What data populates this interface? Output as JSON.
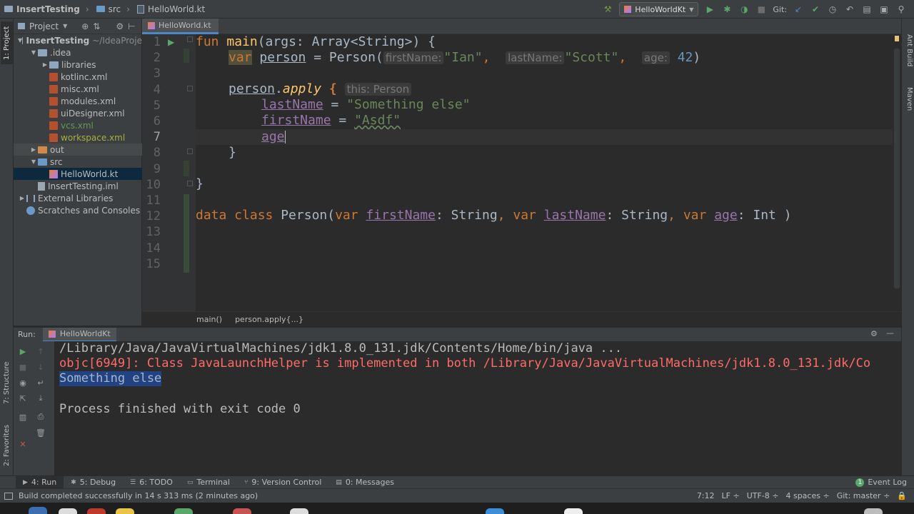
{
  "breadcrumbs": [
    "InsertTesting",
    "src",
    "HelloWorld.kt"
  ],
  "run_config": "HelloWorldKt",
  "git_label": "Git:",
  "left_stripe": [
    "1: Project",
    "7: Structure",
    "2: Favorites"
  ],
  "right_stripe": [
    "Ant Build",
    "Maven"
  ],
  "project_panel": {
    "view": "Project",
    "tree": [
      {
        "label": "InsertTesting",
        "suffix": "~/IdeaProje",
        "depth": 0,
        "arrow": "down",
        "icon": "folder",
        "bold": true
      },
      {
        "label": ".idea",
        "depth": 1,
        "arrow": "down",
        "icon": "folder"
      },
      {
        "label": "libraries",
        "depth": 2,
        "arrow": "right",
        "icon": "folder"
      },
      {
        "label": "kotlinc.xml",
        "depth": 2,
        "arrow": "",
        "icon": "xml"
      },
      {
        "label": "misc.xml",
        "depth": 2,
        "arrow": "",
        "icon": "xml"
      },
      {
        "label": "modules.xml",
        "depth": 2,
        "arrow": "",
        "icon": "xml"
      },
      {
        "label": "uiDesigner.xml",
        "depth": 2,
        "arrow": "",
        "icon": "xml"
      },
      {
        "label": "vcs.xml",
        "depth": 2,
        "arrow": "",
        "icon": "xml",
        "color": "#629755"
      },
      {
        "label": "workspace.xml",
        "depth": 2,
        "arrow": "",
        "icon": "xml",
        "color": "#a6b03d"
      },
      {
        "label": "out",
        "depth": 1,
        "arrow": "right",
        "icon": "folder-orange",
        "highlight": true
      },
      {
        "label": "src",
        "depth": 1,
        "arrow": "down",
        "icon": "folder-blue"
      },
      {
        "label": "HelloWorld.kt",
        "depth": 2,
        "arrow": "",
        "icon": "kt",
        "selected": true
      },
      {
        "label": "InsertTesting.iml",
        "depth": 1,
        "arrow": "",
        "icon": "iml"
      },
      {
        "label": "External Libraries",
        "depth": 0,
        "arrow": "right",
        "icon": "lib"
      },
      {
        "label": "Scratches and Consoles",
        "depth": 0,
        "arrow": "",
        "icon": "scratch"
      }
    ]
  },
  "editor": {
    "tab": "HelloWorld.kt",
    "line_numbers": [
      "1",
      "2",
      "3",
      "4",
      "5",
      "6",
      "7",
      "8",
      "9",
      "10",
      "11",
      "12",
      "13",
      "14",
      "15"
    ],
    "current_line": 7,
    "code": {
      "l1_fun": "fun ",
      "l1_main": "main",
      "l1_rest": "(args: Array<String>) {",
      "l2_var": "var",
      "l2_person": "person",
      "l2_eq": " = Person(",
      "l2_hint1": "firstName:",
      "l2_str1": "\"Ian\"",
      "l2_comma": ",",
      "l2_hint2": "lastName:",
      "l2_str2": "\"Scott\"",
      "l2_hint3": "age:",
      "l2_num": "42",
      "l2_close": ")",
      "l4_person": "person",
      "l4_dot": ".",
      "l4_apply": "apply",
      "l4_brace": " {",
      "l4_hint": "this: Person",
      "l5_prop": "lastName",
      "l5_eq": " = ",
      "l5_str": "\"Something else\"",
      "l6_prop": "firstName",
      "l6_eq": " = ",
      "l6_str": "\"Asdf\"",
      "l7_prop": "age",
      "l8": "}",
      "l10": "}",
      "l12_data": "data class ",
      "l12_person": "Person(",
      "l12_var1": "var ",
      "l12_p1": "firstName",
      "l12_t1": ": String",
      "l12_c1": ", ",
      "l12_var2": "var ",
      "l12_p2": "lastName",
      "l12_t2": ": String",
      "l12_c2": ", ",
      "l12_var3": "var ",
      "l12_p3": "age",
      "l12_t3": ": Int )"
    },
    "breadcrumbs": [
      "main()",
      "person.apply{...}"
    ]
  },
  "run_panel": {
    "label": "Run:",
    "tab": "HelloWorldKt",
    "console": [
      {
        "text": "/Library/Java/JavaVirtualMachines/jdk1.8.0_131.jdk/Contents/Home/bin/java ...",
        "color": "#bbbbbb"
      },
      {
        "text": "objc[6949]: Class JavaLaunchHelper is implemented in both /Library/Java/JavaVirtualMachines/jdk1.8.0_131.jdk/Co",
        "color": "#ff6b68"
      },
      {
        "text": "Something else",
        "color": "#a9b7c6",
        "selected": true
      },
      {
        "text": "",
        "color": "#bbbbbb"
      },
      {
        "text": "Process finished with exit code 0",
        "color": "#bbbbbb"
      }
    ]
  },
  "bottom_tabs": [
    {
      "label": "4: Run",
      "icon": "run-icon",
      "active": true
    },
    {
      "label": "5: Debug",
      "icon": "debug-icon"
    },
    {
      "label": "6: TODO",
      "icon": "todo-icon"
    },
    {
      "label": "Terminal",
      "icon": "terminal-icon"
    },
    {
      "label": "9: Version Control",
      "icon": "vcs-icon"
    },
    {
      "label": "0: Messages",
      "icon": "messages-icon"
    }
  ],
  "event_log": {
    "badge": "1",
    "label": "Event Log"
  },
  "status": {
    "message": "Build completed successfully in 14 s 313 ms (2 minutes ago)",
    "position": "7:12",
    "line_sep": "LF ÷",
    "encoding": "UTF-8 ÷",
    "indent": "4 spaces ÷",
    "branch": "Git: master ÷"
  },
  "colors": {
    "accent": "#4a88c7",
    "keyword": "#cc7832",
    "string": "#6a8759",
    "property": "#9876aa",
    "function": "#ffc66d",
    "error": "#ff6b68"
  }
}
